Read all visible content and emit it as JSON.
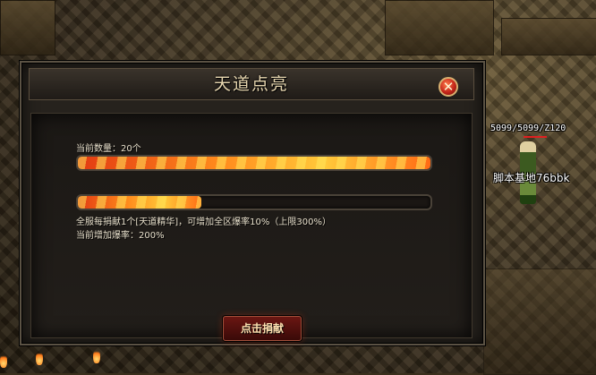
{
  "dialog": {
    "title": "天道点亮",
    "close_icon": "close-icon",
    "current_count_label": "当前数量：20个",
    "count_progress": 1.0,
    "donate_progress": 0.35,
    "info_line": "全服每捐献1个[天道精华]，可增加全区爆率10%（上限300%）",
    "current_rate_label": "当前增加爆率：200%",
    "donate_button": "点击捐献"
  },
  "player": {
    "name_tag": "5099/5099/Z120",
    "guild_tag": "脚本基地76bbk"
  },
  "colors": {
    "title_text": "#e8d7b0",
    "bar_fill": "#ff8a1c",
    "close_button": "#c4261a"
  }
}
